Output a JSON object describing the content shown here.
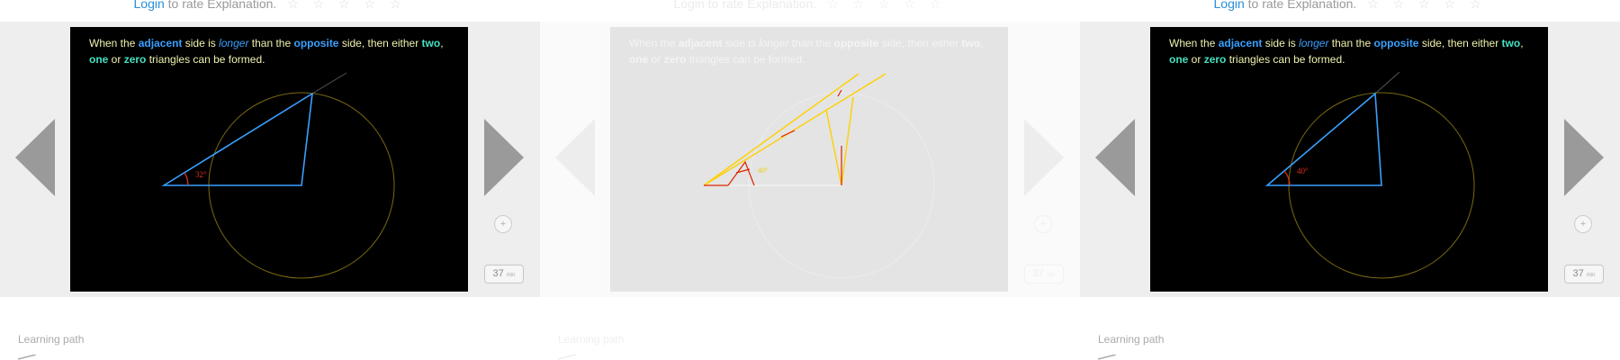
{
  "rating": {
    "login_label": "Login",
    "suffix": " to rate Explanation.",
    "stars": "☆ ☆ ☆ ☆ ☆"
  },
  "slide_text": {
    "p1": "When the ",
    "adjacent": "adjacent",
    "p2": " side is ",
    "longer": "longer",
    "p3": " than the ",
    "opposite": "opposite",
    "p4": " side, then either ",
    "two": "two",
    "p5": ",",
    "one": "one",
    "p6": " or ",
    "zero": "zero",
    "p7": " triangles can be formed."
  },
  "colors": {
    "triangle": "#39a0ff",
    "circle": "#7a6a10",
    "angle_arc": "#e03020",
    "trace": "#ffd000",
    "trace_red": "#dd2200"
  },
  "panels": [
    {
      "state": "active",
      "angle_label": "32°",
      "count": "37",
      "count_unit": "min"
    },
    {
      "state": "fading",
      "angle_label": "40°",
      "count": "37",
      "count_unit": "min"
    },
    {
      "state": "active",
      "angle_label": "40°",
      "count": "37",
      "count_unit": "min"
    }
  ],
  "icons": {
    "prev": "triangle-left-icon",
    "next": "triangle-right-icon",
    "plus": "plus-icon"
  },
  "footer": {
    "learning_path_label": "Learning path"
  }
}
